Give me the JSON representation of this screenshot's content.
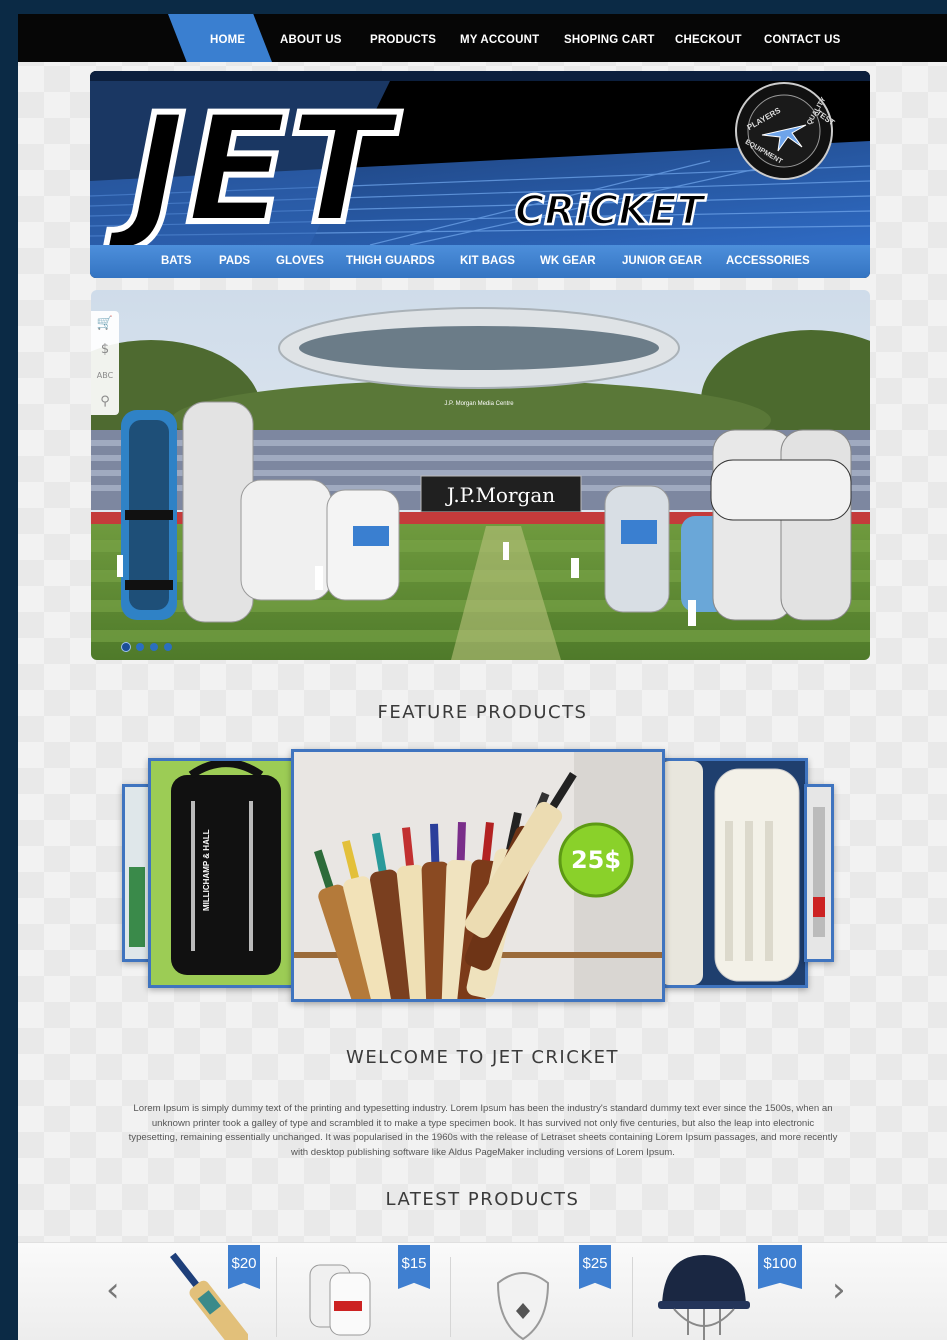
{
  "nav": {
    "items": [
      {
        "label": "HOME",
        "active": true
      },
      {
        "label": "ABOUT US"
      },
      {
        "label": "PRODUCTS"
      },
      {
        "label": "MY ACCOUNT"
      },
      {
        "label": "SHOPING CART"
      },
      {
        "label": "CHECKOUT"
      },
      {
        "label": "CONTACT US"
      }
    ]
  },
  "banner": {
    "logo_text": "JET",
    "sub_text": "CRiCKET",
    "badge_lines": [
      "PLAYERS",
      "TEST",
      "QUALITY",
      "EQUIPMENT"
    ]
  },
  "categories": [
    "BATS",
    "PADS",
    "GLOVES",
    "THIGH GUARDS",
    "KIT BAGS",
    "WK GEAR",
    "JUNIOR GEAR",
    "ACCESSORIES"
  ],
  "slider": {
    "tools": [
      "cart-icon",
      "dollar-icon",
      "abc-icon",
      "search-icon"
    ],
    "tool_glyphs": [
      "🛒",
      "$",
      "ABC",
      "⚲"
    ],
    "sign_text": "J.P.Morgan",
    "media_centre_text": "J.P. Morgan Media Centre",
    "dots": 4,
    "active_dot": 0
  },
  "featured": {
    "title": "FEATURE PRODUCTS",
    "bag_brand": "MILLICHAMP & HALL",
    "price_badge": "25$"
  },
  "welcome": {
    "title": "WELCOME TO JET CRICKET",
    "text": "Lorem Ipsum is simply dummy text of the printing and typesetting industry. Lorem Ipsum has been the industry's standard dummy text ever since the 1500s, when an unknown printer took a galley of type and scrambled it to make a type specimen book. It has survived not only five centuries, but also the leap into electronic typesetting, remaining essentially unchanged. It was popularised in the 1960s with the release of Letraset sheets containing Lorem Ipsum passages, and more recently with desktop publishing software like Aldus PageMaker including versions of Lorem Ipsum."
  },
  "latest": {
    "title": "LATEST PRODUCTS",
    "prev": "‹",
    "next": "›",
    "products": [
      {
        "name": "bat",
        "price": "$20"
      },
      {
        "name": "gloves",
        "price": "$15"
      },
      {
        "name": "abdominal guard",
        "price": "$25"
      },
      {
        "name": "helmet",
        "price": "$100"
      }
    ]
  },
  "colors": {
    "accent": "#3a7fd0",
    "nav_bg": "#060606",
    "frame_border": "#3f74bf"
  }
}
